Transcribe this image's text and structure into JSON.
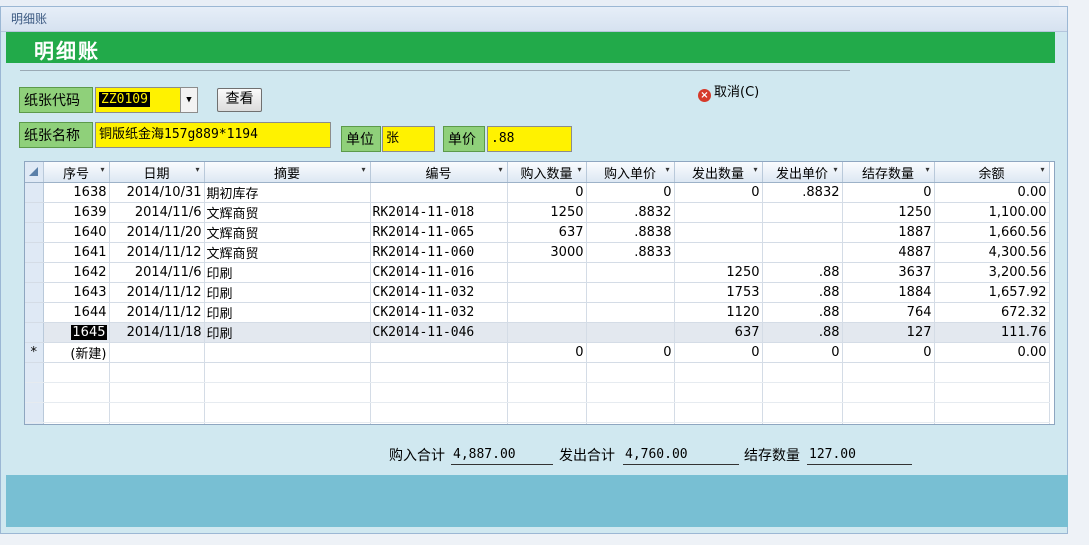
{
  "window": {
    "title": "明细账"
  },
  "header": {
    "title": "明细账"
  },
  "form": {
    "code_label": "纸张代码",
    "code_value": "ZZ0109",
    "view_button": "查看",
    "name_label": "纸张名称",
    "name_value": "铜版纸金海157g889*1194",
    "unit_label": "单位",
    "unit_value": "张",
    "price_label": "单价",
    "price_value": ".88",
    "cancel_label": "取消(C)"
  },
  "table": {
    "columns": [
      "序号",
      "日期",
      "摘要",
      "编号",
      "购入数量",
      "购入单价",
      "发出数量",
      "发出单价",
      "结存数量",
      "余额"
    ],
    "rows": [
      {
        "seq": "1638",
        "date": "2014/10/31",
        "summary": "期初库存",
        "code": "",
        "in_qty": "0",
        "in_price": "0",
        "out_qty": "0",
        "out_price": ".8832",
        "bal_qty": "0",
        "amount": "0.00"
      },
      {
        "seq": "1639",
        "date": "2014/11/6",
        "summary": "文辉商贸",
        "code": "RK2014-11-018",
        "in_qty": "1250",
        "in_price": ".8832",
        "out_qty": "",
        "out_price": "",
        "bal_qty": "1250",
        "amount": "1,100.00"
      },
      {
        "seq": "1640",
        "date": "2014/11/20",
        "summary": "文辉商贸",
        "code": "RK2014-11-065",
        "in_qty": "637",
        "in_price": ".8838",
        "out_qty": "",
        "out_price": "",
        "bal_qty": "1887",
        "amount": "1,660.56"
      },
      {
        "seq": "1641",
        "date": "2014/11/12",
        "summary": "文辉商贸",
        "code": "RK2014-11-060",
        "in_qty": "3000",
        "in_price": ".8833",
        "out_qty": "",
        "out_price": "",
        "bal_qty": "4887",
        "amount": "4,300.56"
      },
      {
        "seq": "1642",
        "date": "2014/11/6",
        "summary": "印刷",
        "code": "CK2014-11-016",
        "in_qty": "",
        "in_price": "",
        "out_qty": "1250",
        "out_price": ".88",
        "bal_qty": "3637",
        "amount": "3,200.56"
      },
      {
        "seq": "1643",
        "date": "2014/11/12",
        "summary": "印刷",
        "code": "CK2014-11-032",
        "in_qty": "",
        "in_price": "",
        "out_qty": "1753",
        "out_price": ".88",
        "bal_qty": "1884",
        "amount": "1,657.92"
      },
      {
        "seq": "1644",
        "date": "2014/11/12",
        "summary": "印刷",
        "code": "CK2014-11-032",
        "in_qty": "",
        "in_price": "",
        "out_qty": "1120",
        "out_price": ".88",
        "bal_qty": "764",
        "amount": "672.32"
      },
      {
        "seq": "1645",
        "date": "2014/11/18",
        "summary": "印刷",
        "code": "CK2014-11-046",
        "in_qty": "",
        "in_price": "",
        "out_qty": "637",
        "out_price": ".88",
        "bal_qty": "127",
        "amount": "111.76"
      }
    ],
    "new_row": {
      "marker": "*",
      "seq": "(新建)",
      "in_qty": "0",
      "in_price": "0",
      "out_qty": "0",
      "out_price": "0",
      "bal_qty": "0",
      "amount": "0.00"
    }
  },
  "summary": {
    "in_label": "购入合计",
    "in_value": "4,887.00",
    "out_label": "发出合计",
    "out_value": "4,760.00",
    "bal_label": "结存数量",
    "bal_value": "127.00"
  }
}
